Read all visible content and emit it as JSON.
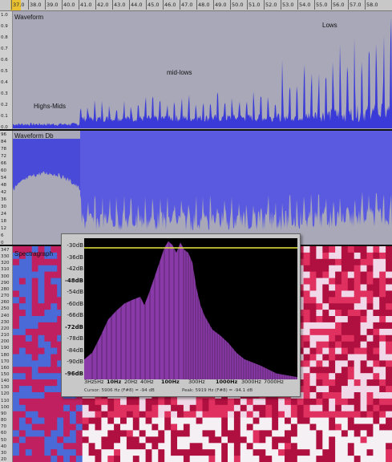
{
  "ruler": {
    "ticks": [
      "37.0",
      "38.0",
      "39.0",
      "40.0",
      "41.0",
      "42.0",
      "43.0",
      "44.0",
      "45.0",
      "46.0",
      "47.0",
      "48.0",
      "49.0",
      "50.0",
      "51.0",
      "52.0",
      "53.0",
      "54.0",
      "55.0",
      "56.0",
      "57.0",
      "58.0"
    ]
  },
  "waveform_track": {
    "label": "Waveform",
    "scale": [
      "1.0",
      "0.9",
      "0.8",
      "0.7",
      "0.6",
      "0.5",
      "0.4",
      "0.3",
      "0.2",
      "0.1",
      "0.0"
    ],
    "annotations": {
      "highs_mids": "Highs-Mids",
      "mid_lows": "mid-lows",
      "lows": "Lows"
    },
    "color": "#3a3ad8",
    "background": "#a8a8b8"
  },
  "waveform_db_track": {
    "label": "Waveform Db",
    "scale": [
      "96",
      "84",
      "78",
      "72",
      "66",
      "60",
      "54",
      "48",
      "42",
      "36",
      "30",
      "24",
      "18",
      "12",
      "6",
      "0"
    ],
    "color": "#5a5ae0"
  },
  "spectrograph_track": {
    "label": "Spectragraph",
    "scale": [
      "347",
      "330",
      "320",
      "310",
      "300",
      "290",
      "280",
      "270",
      "260",
      "250",
      "240",
      "230",
      "220",
      "210",
      "200",
      "190",
      "180",
      "170",
      "160",
      "150",
      "140",
      "130",
      "120",
      "110",
      "100",
      "90",
      "80",
      "70",
      "60",
      "50",
      "40",
      "30",
      "20"
    ]
  },
  "spectrum_popup": {
    "db_labels": [
      "-30dB",
      "-36dB",
      "-42dB",
      "-48dB",
      "-54dB",
      "-60dB",
      "-66dB",
      "-72dB",
      "-78dB",
      "-84dB",
      "-90dB",
      "-96dB"
    ],
    "hz_labels": [
      "3Hz",
      "5Hz",
      "10Hz",
      "20Hz",
      "40Hz",
      "100Hz",
      "300Hz",
      "1000Hz",
      "3000Hz",
      "7000Hz"
    ],
    "cursor_text": "Cursor: 5906 Hz (F#8) = -94 dB",
    "peak_text": "Peak: 5919 Hz (F#8) = -94.1 dB",
    "fill_color": "#8a3aa8",
    "line_color": "#e8e840"
  }
}
